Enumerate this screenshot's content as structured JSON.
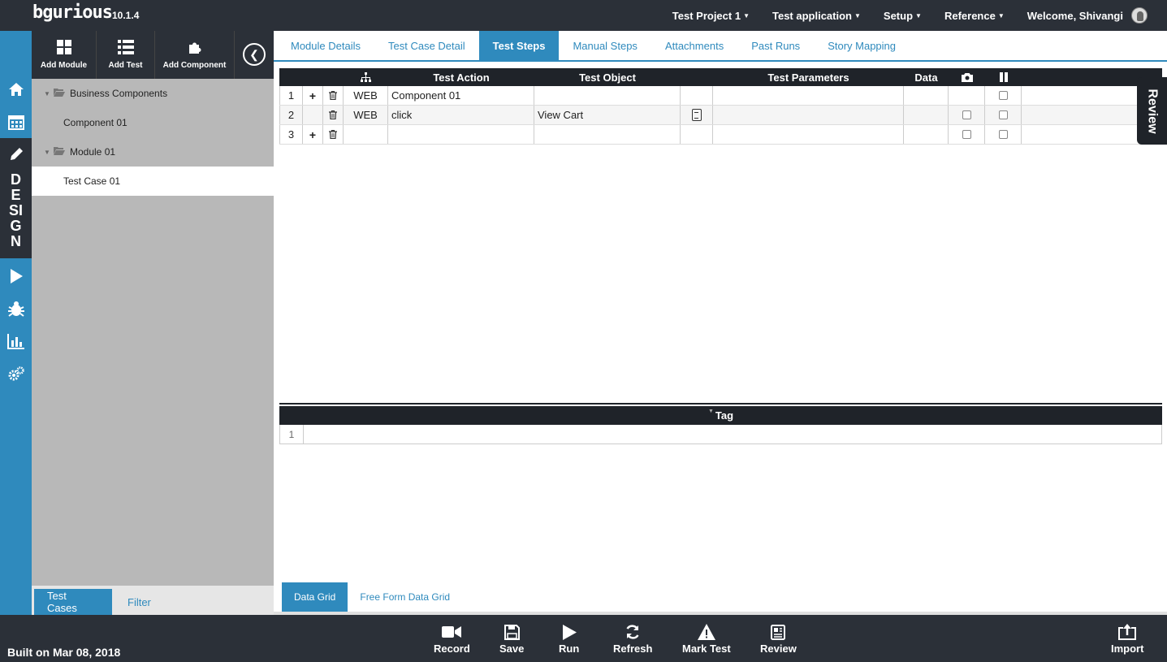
{
  "app": {
    "logo": "bgurious",
    "version": "10.1.4"
  },
  "topnav": {
    "project": "Test Project 1",
    "application": "Test application",
    "setup": "Setup",
    "reference": "Reference",
    "welcome": "Welcome, Shivangi"
  },
  "leftrail": {
    "design_label": [
      "D",
      "E",
      "SI",
      "G",
      "N"
    ],
    "icons": [
      "home-icon",
      "calendar-icon",
      "pencil-icon",
      "play-icon",
      "bug-icon",
      "chart-icon",
      "gears-icon"
    ]
  },
  "sidebar": {
    "toolbar": {
      "add_module": "Add Module",
      "add_test": "Add Test",
      "add_component": "Add Component"
    },
    "tree": {
      "business_components": "Business Components",
      "component_01": "Component 01",
      "module_01": "Module 01",
      "test_case_01": "Test Case 01"
    },
    "bottom_tabs": {
      "test_cases": "Test Cases",
      "filter": "Filter"
    }
  },
  "tabs": [
    "Module Details",
    "Test Case Detail",
    "Test Steps",
    "Manual Steps",
    "Attachments",
    "Past Runs",
    "Story Mapping"
  ],
  "active_tab": "Test Steps",
  "steps_grid": {
    "headers": {
      "action": "Test Action",
      "object": "Test Object",
      "params": "Test Parameters",
      "data": "Data"
    },
    "rows": [
      {
        "num": "1",
        "plus": "+",
        "platform": "WEB",
        "action": "Component 01",
        "object": "",
        "has_object_btn": false,
        "cam_checkbox": false,
        "pause_checked": false
      },
      {
        "num": "2",
        "plus": "",
        "platform": "WEB",
        "action": "click",
        "object": "View Cart",
        "has_object_btn": true,
        "cam_checkbox": true,
        "pause_checked": false
      },
      {
        "num": "3",
        "plus": "+",
        "platform": "",
        "action": "",
        "object": "",
        "has_object_btn": false,
        "cam_checkbox": true,
        "pause_checked": false
      }
    ]
  },
  "review_tab": "Review",
  "tag_grid": {
    "header": "Tag",
    "rows": [
      "1"
    ]
  },
  "bottom_tabs": {
    "data_grid": "Data Grid",
    "free_form": "Free Form Data Grid"
  },
  "footer": {
    "built": "Built on Mar 08, 2018",
    "record": "Record",
    "save": "Save",
    "run": "Run",
    "refresh": "Refresh",
    "mark_test": "Mark Test",
    "review": "Review",
    "import": "Import"
  }
}
